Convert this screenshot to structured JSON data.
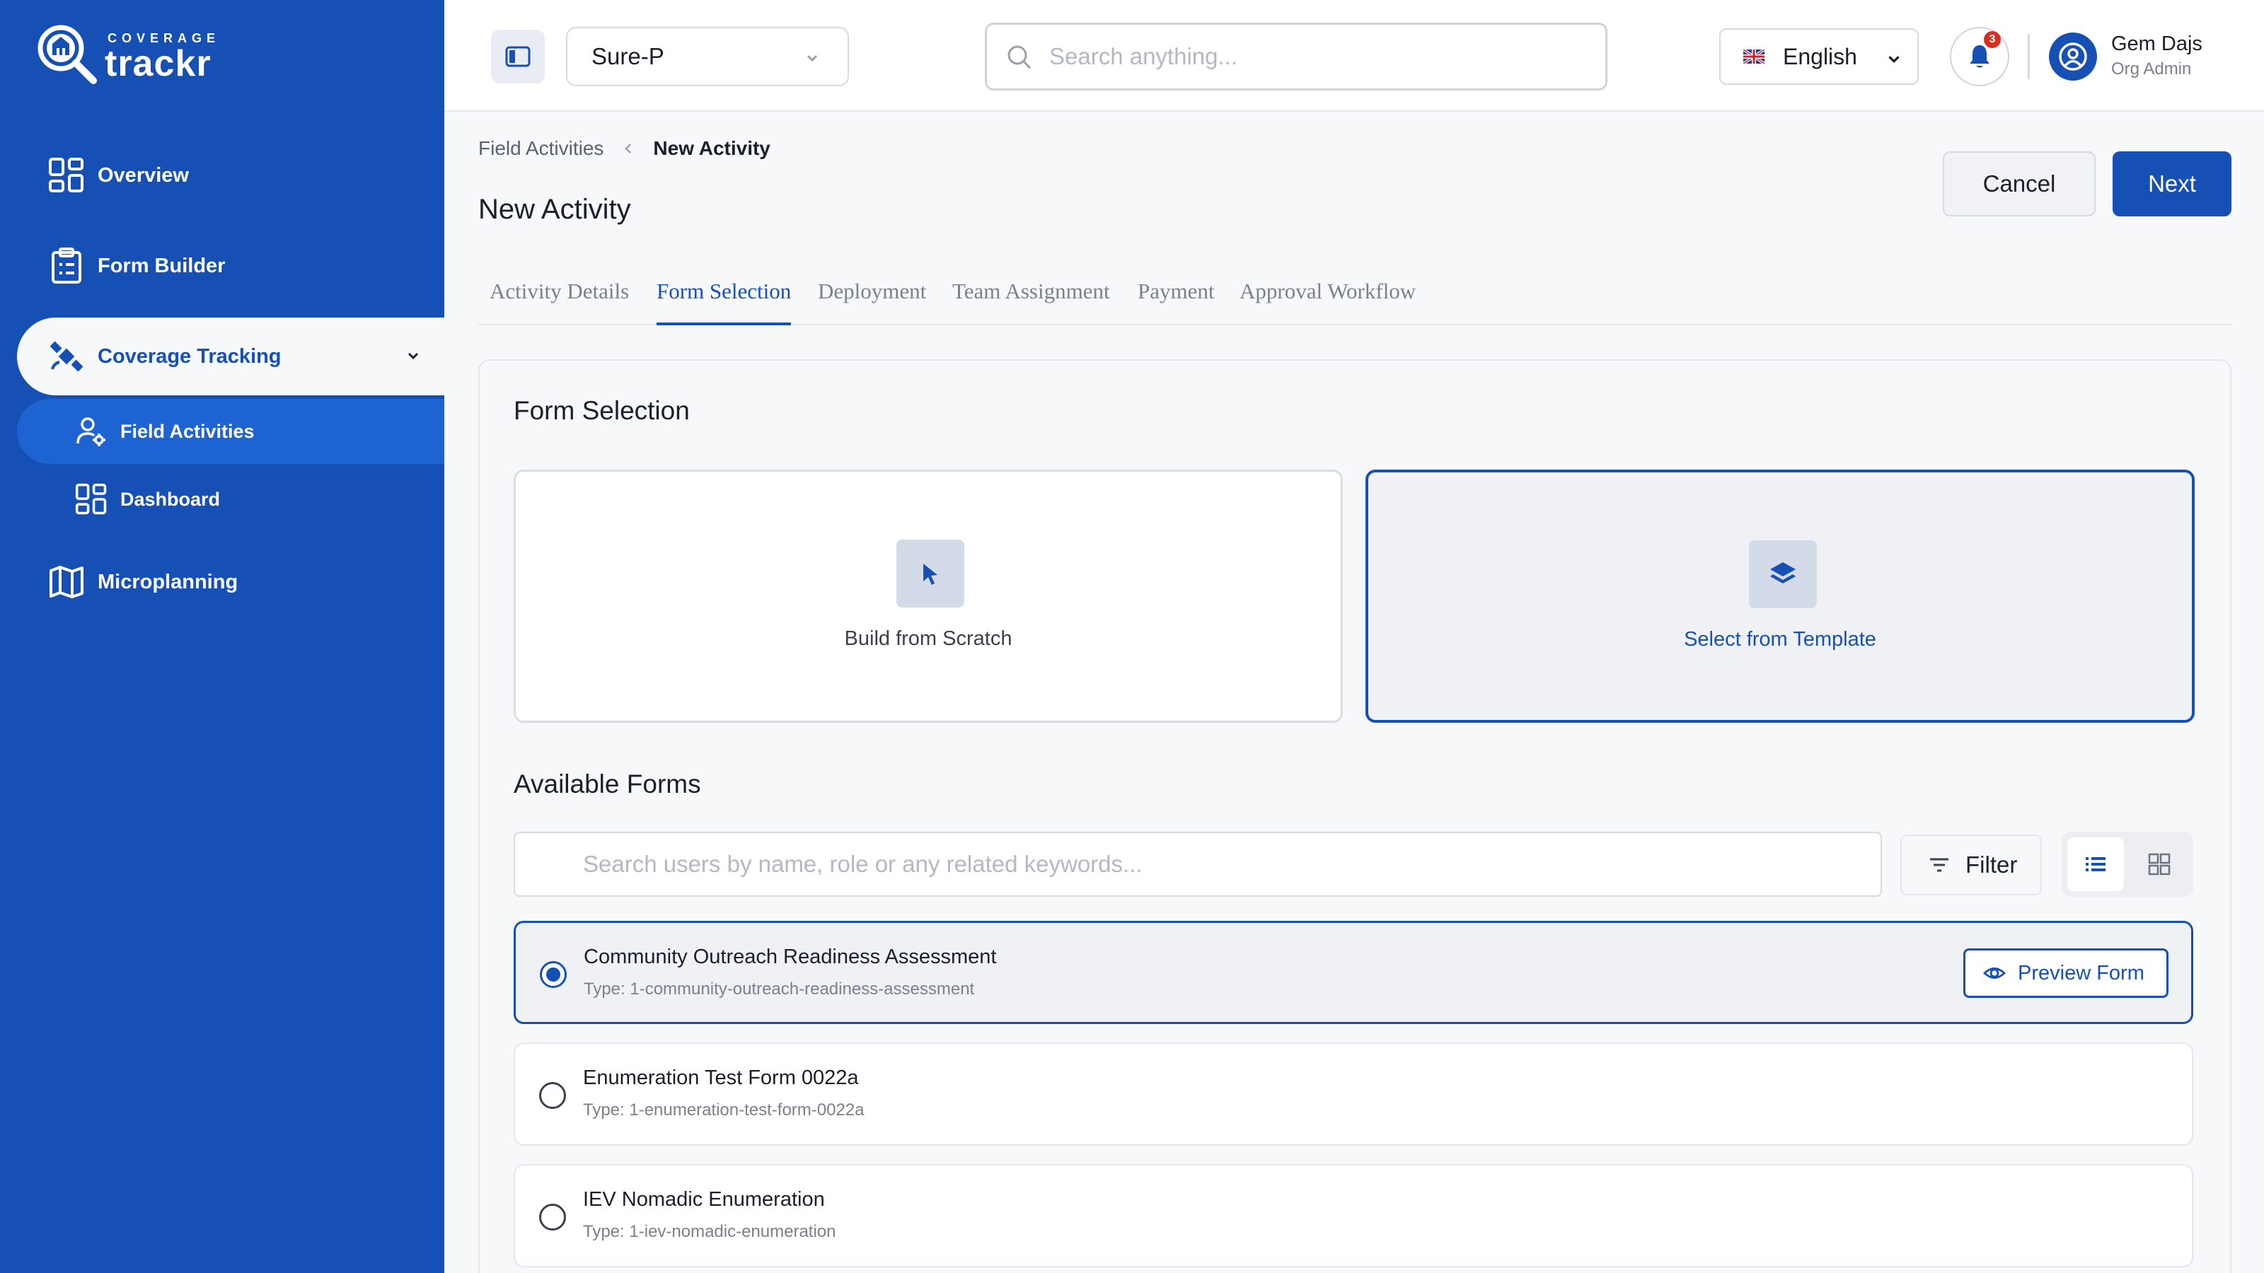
{
  "brand": {
    "top": "COVERAGE",
    "main": "trackr"
  },
  "sidebar": {
    "items": [
      {
        "label": "Overview",
        "icon": "grid-icon"
      },
      {
        "label": "Form Builder",
        "icon": "clipboard-icon"
      },
      {
        "label": "Coverage Tracking",
        "icon": "satellite-icon"
      },
      {
        "label": "Microplanning",
        "icon": "map-icon"
      }
    ],
    "subitems": [
      {
        "label": "Field Activities",
        "icon": "users-gear-icon"
      },
      {
        "label": "Dashboard",
        "icon": "grid-icon"
      }
    ]
  },
  "header": {
    "org": "Sure-P",
    "search_placeholder": "Search anything...",
    "language": "English",
    "notification_count": "3",
    "user_name": "Gem Dajs",
    "user_role": "Org Admin"
  },
  "breadcrumb": {
    "parent": "Field Activities",
    "current": "New Activity"
  },
  "page": {
    "title": "New Activity",
    "cancel": "Cancel",
    "next": "Next"
  },
  "tabs": [
    "Activity Details",
    "Form Selection",
    "Deployment",
    "Team Assignment",
    "Payment",
    "Approval Workflow"
  ],
  "form_selection": {
    "title": "Form Selection",
    "option_scratch": "Build from Scratch",
    "option_template": "Select from Template"
  },
  "available_forms": {
    "title": "Available Forms",
    "search_placeholder": "Search users by name, role or any related keywords...",
    "filter": "Filter",
    "preview": "Preview Form",
    "rows": [
      {
        "name": "Community Outreach Readiness Assessment",
        "type": "Type: 1-community-outreach-readiness-assessment"
      },
      {
        "name": "Enumeration Test Form 0022a",
        "type": "Type: 1-enumeration-test-form-0022a"
      },
      {
        "name": "IEV Nomadic Enumeration",
        "type": "Type: 1-iev-nomadic-enumeration"
      }
    ]
  },
  "colors": {
    "primary": "#1650b4",
    "sidebar": "#1650b4",
    "active_sub": "#1e63d2",
    "badge": "#d92d20"
  }
}
